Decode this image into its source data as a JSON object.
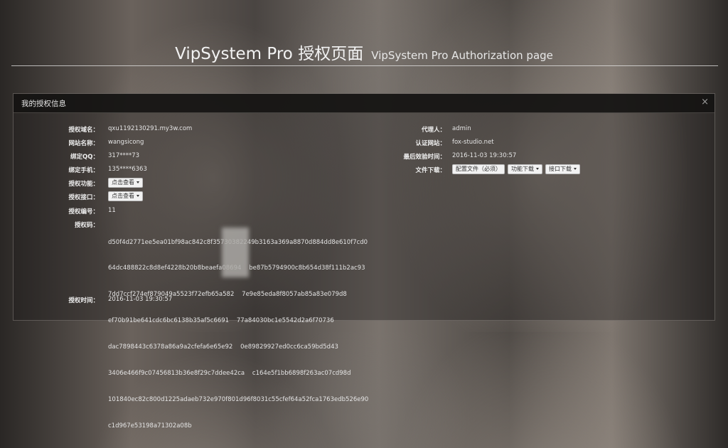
{
  "header": {
    "title_main": "VipSystem Pro 授权页面",
    "title_sub": "VipSystem Pro Authorization page"
  },
  "panel": {
    "title": "我的授权信息",
    "close_icon": "×"
  },
  "left_fields": {
    "domain": {
      "label": "授权域名：",
      "value": "qxu1192130291.my3w.com"
    },
    "site_name": {
      "label": "网站名称：",
      "value": "wangsicong"
    },
    "qq": {
      "label": "绑定QQ：",
      "value": "317****73"
    },
    "phone": {
      "label": "绑定手机：",
      "value": "135****6363"
    },
    "features": {
      "label": "授权功能：",
      "button": "点击查看"
    },
    "api": {
      "label": "授权接口：",
      "button": "点击查看"
    },
    "number": {
      "label": "授权编号：",
      "value": "11"
    },
    "code": {
      "label": "授权码：",
      "lines": [
        "d50f4d2771ee5ea01bf98ac842c8f35730382249b3163a369a8870d884dd8e610f7cd0",
        "64dc488822c8d8ef4228b20b8beaefa08694    be87b5794900c8b654d38f111b2ac93",
        "7dd7ccf274ef879049a5523f72efb65a582    7e9e85eda8f8057ab85a83e079d8",
        "ef70b91be641cdc6bc6138b35af5c6691    77a84030bc1e5542d2a6f70736",
        "dac7898443c6378a86a9a2cfefa6e65e92    0e89829927ed0cc6ca59bd5d43",
        "3406e466f9c07456813b36e8f29c7ddee42ca    c164e5f1bb6898f263ac07cd98d",
        "101840ec82c800d1225adaeb732e970f801d96f8031c55cfef64a52fca1763edb526e90",
        "c1d967e53198a71302a08b"
      ]
    },
    "time": {
      "label": "授权时间：",
      "value": "2016-11-03 19:30:57"
    }
  },
  "right_fields": {
    "agent": {
      "label": "代理人：",
      "value": "admin"
    },
    "cert_site": {
      "label": "认证网站：",
      "value": "fox-studio.net"
    },
    "last_effective": {
      "label": "最后效验时间：",
      "value": "2016-11-03 19:30:57"
    },
    "downloads": {
      "label": "文件下载：",
      "buttons": [
        "配置文件（必须）",
        "功能下载",
        "接口下载"
      ]
    }
  }
}
